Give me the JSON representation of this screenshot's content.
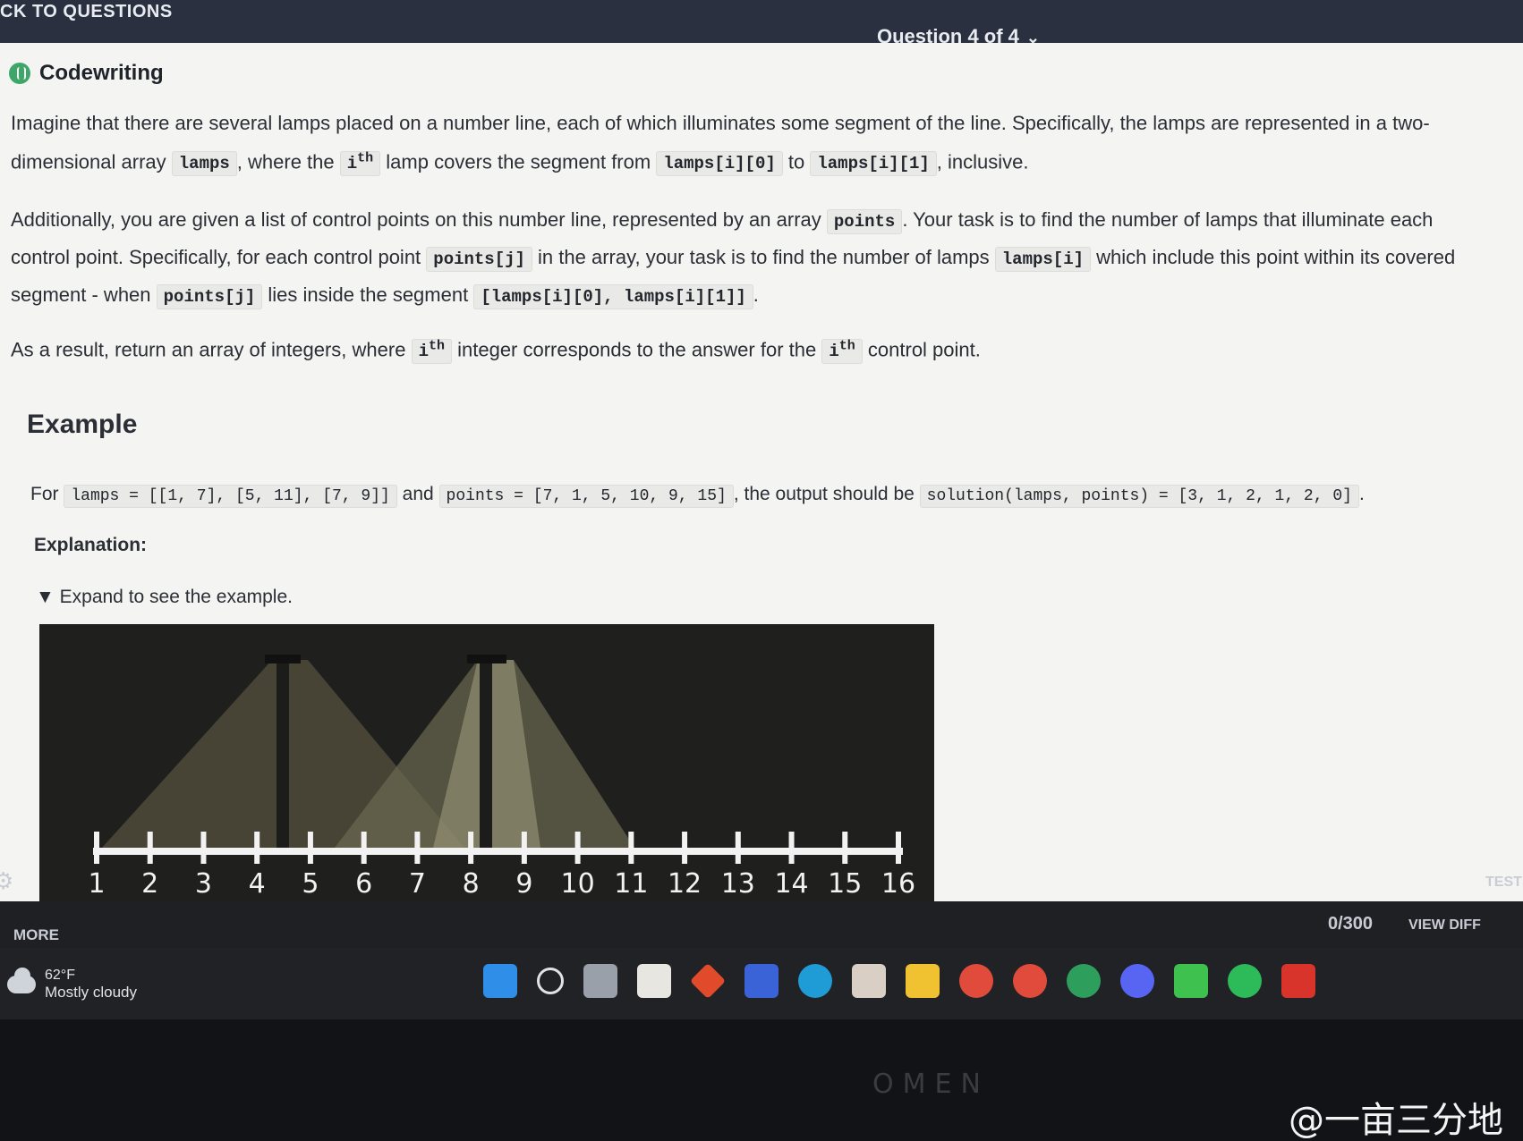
{
  "topbar": {
    "back_label": "CK TO QUESTIONS",
    "question_selector": "Question 4 of 4"
  },
  "task": {
    "type_label": "Codewriting",
    "p1": {
      "a": "Imagine that there are several lamps placed on a number line, each of which illuminates some segment of the line. Specifically, the lamps are represented in a two-dimensional array",
      "code_lamps": "lamps",
      "b": ", where the",
      "ith_i": "i",
      "ith_th": "th",
      "c": "lamp covers the segment from",
      "code_start": "lamps[i][0]",
      "d": "to",
      "code_end": "lamps[i][1]",
      "e": ", inclusive."
    },
    "p2": {
      "a": "Additionally, you are given a list of control points on this number line, represented by an array",
      "code_points": "points",
      "b": ". Your task is to find the number of lamps that illuminate each control point. Specifically, for each control point",
      "code_pj": "points[j]",
      "c": "in the array, your task is to find the number of lamps",
      "code_li": "lamps[i]",
      "d": "which include this point within its covered segment - when",
      "code_pj2": "points[j]",
      "e": "lies inside the segment",
      "code_seg": "[lamps[i][0], lamps[i][1]]",
      "f": "."
    },
    "p3": {
      "a": "As a result, return an array of integers, where",
      "ith_i": "i",
      "ith_th": "th",
      "b": "integer corresponds to the answer for the",
      "c": "control point."
    },
    "example_heading": "Example",
    "example": {
      "for": "For",
      "lamps_code": "lamps = [[1, 7], [5, 11], [7, 9]]",
      "and": "and",
      "points_code": "points = [7, 1, 5, 10, 9, 15]",
      "mid": ", the output should be",
      "solution_code": "solution(lamps, points) = [3, 1, 2, 1, 2, 0]",
      "end": "."
    },
    "explanation_label": "Explanation:",
    "expand_label": "Expand to see the example.",
    "figure": {
      "ticks": [
        "1",
        "2",
        "3",
        "4",
        "5",
        "6",
        "7",
        "8",
        "9",
        "10",
        "11",
        "12",
        "13",
        "14",
        "15",
        "16"
      ]
    }
  },
  "bottombar": {
    "more_label": "MORE",
    "char_count": "0/300",
    "view_diff": "VIEW DIFF",
    "tests_label": "TEST"
  },
  "taskbar": {
    "weather_temp": "62°F",
    "weather_desc": "Mostly cloudy"
  },
  "bezel": {
    "brand": "OMEN",
    "watermark": "@一亩三分地"
  },
  "colors": {
    "topbar_bg": "#2a3040",
    "panel_bg": "#f4f4f2",
    "accent_green": "#3fa66a",
    "figure_bg": "#1f1f1d"
  }
}
